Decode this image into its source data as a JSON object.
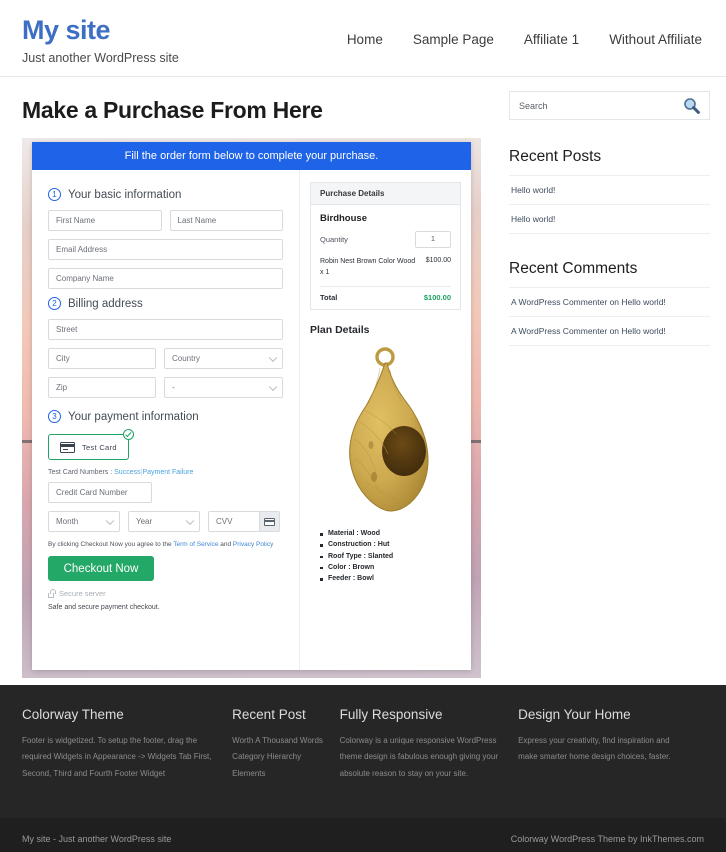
{
  "header": {
    "site_title": "My site",
    "tagline": "Just another WordPress site",
    "nav": [
      {
        "label": "Home"
      },
      {
        "label": "Sample Page"
      },
      {
        "label": "Affiliate 1"
      },
      {
        "label": "Without Affiliate"
      }
    ]
  },
  "main": {
    "page_title": "Make a Purchase From Here",
    "form": {
      "banner": "Fill the order form below to complete your purchase.",
      "steps": [
        {
          "num": "1",
          "label": "Your basic information"
        },
        {
          "num": "2",
          "label": "Billing address"
        },
        {
          "num": "3",
          "label": "Your payment information"
        }
      ],
      "fields": {
        "first_name": "First Name",
        "last_name": "Last Name",
        "email": "Email Address",
        "company": "Company Name",
        "street": "Street",
        "city": "City",
        "country": "Country",
        "zip": "Zip",
        "state": "-",
        "credit_card": "Credit Card Number",
        "month": "Month",
        "year": "Year",
        "cvv": "CVV"
      },
      "test_card_button": "Test Card",
      "test_numbers_prefix": "Test Card Numbers :",
      "test_success": "Success",
      "test_separator": "|",
      "test_failure": "Payment Failure",
      "tos_prefix": "By clicking Checkout Now you agree to the",
      "tos_link": "Term of Service",
      "tos_and": "and",
      "privacy_link": "Privacy Policy",
      "checkout_label": "Checkout Now",
      "secure_server": "Secure server",
      "safe_note": "Safe and secure payment checkout."
    },
    "purchase_details": {
      "heading": "Purchase Details",
      "product": "Birdhouse",
      "quantity_label": "Quantity",
      "quantity_value": "1",
      "line_item_name": "Robin Nest Brown Color Wood x 1",
      "line_item_price": "$100.00",
      "total_label": "Total",
      "total_value": "$100.00"
    },
    "plan": {
      "title": "Plan Details",
      "image_alt": "birdhouse-product-image",
      "specs": [
        "Material : Wood",
        "Construction : Hut",
        "Roof Type : Slanted",
        "Color : Brown",
        "Feeder : Bowl"
      ]
    }
  },
  "sidebar": {
    "search_placeholder": "Search",
    "recent_posts_title": "Recent Posts",
    "recent_posts": [
      {
        "label": "Hello world!"
      },
      {
        "label": "Hello world!"
      }
    ],
    "recent_comments_title": "Recent Comments",
    "recent_comments": [
      {
        "label": "A WordPress Commenter on Hello world!"
      },
      {
        "label": "A WordPress Commenter on Hello world!"
      }
    ]
  },
  "footer": {
    "columns": [
      {
        "title": "Colorway Theme",
        "text": "Footer is widgetized. To setup the footer, drag the required Widgets in Appearance -> Widgets Tab First, Second, Third and Fourth Footer Widget"
      },
      {
        "title": "Recent Post",
        "items": [
          {
            "label": "Worth A Thousand Words"
          },
          {
            "label": "Category Hierarchy"
          },
          {
            "label": "Elements"
          }
        ]
      },
      {
        "title": "Fully Responsive",
        "text": "Colorway is a unique responsive WordPress theme design is fabulous enough giving your absolute reason to stay on your site."
      },
      {
        "title": "Design Your Home",
        "text": "Express your creativity, find inspiration and make smarter home design choices, faster."
      }
    ],
    "bottom_left": "My site - Just another WordPress site",
    "bottom_right": "Colorway WordPress Theme by InkThemes.com"
  },
  "colors": {
    "brand_blue": "#3d6fc4",
    "banner_blue": "#1f63e8",
    "accent_green": "#23a867",
    "total_green": "#1ea362",
    "footer_dark": "#262626",
    "footer_bottom": "#1f1f1f"
  }
}
